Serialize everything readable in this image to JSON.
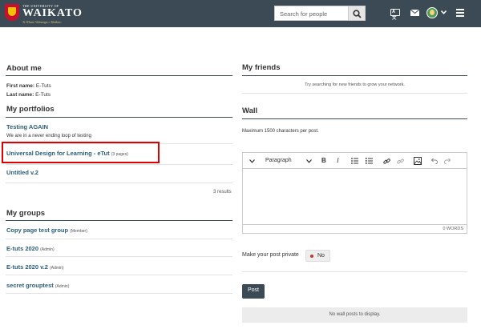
{
  "header": {
    "logo_small": "THE UNIVERSITY OF",
    "logo_name": "WAIKATO",
    "logo_tag": "Te Whare Wānanga o Waikato",
    "search_placeholder": "Search for people",
    "lang_icon_text": "A文"
  },
  "about": {
    "title": "About me",
    "first_name_label": "First name:",
    "first_name_value": "E-Tuts",
    "last_name_label": "Last name:",
    "last_name_value": "E-Tuts"
  },
  "portfolios": {
    "title": "My portfolios",
    "items": [
      {
        "title": "Testing AGAIN",
        "meta": "",
        "description": "We are in a never ending loop of testing"
      },
      {
        "title": "Universal Design for Learning - eTut",
        "meta": "(3 pages)",
        "description": ""
      },
      {
        "title": "Untitled v.2",
        "meta": "",
        "description": ""
      }
    ],
    "results": "3 results"
  },
  "groups": {
    "title": "My groups",
    "items": [
      {
        "name": "Copy page test group",
        "role": "(Member)"
      },
      {
        "name": "E-tuts 2020",
        "role": "(Admin)"
      },
      {
        "name": "E-tuts 2020 v.2",
        "role": "(Admin)"
      },
      {
        "name": "secret grouptest",
        "role": "(Admin)"
      }
    ]
  },
  "friends": {
    "title": "My friends",
    "message": "Try searching for new friends to grow your network."
  },
  "wall": {
    "title": "Wall",
    "max_chars": "Maximum 1500 characters per post.",
    "paragraph_label": "Paragraph",
    "word_count": "0 WORDS",
    "private_label": "Make your post private",
    "private_value": "No",
    "post_button": "Post",
    "empty_message": "No wall posts to display."
  },
  "colors": {
    "header_bg": "#3b4a55",
    "link": "#2d5e7a",
    "highlight_border": "#e00000"
  }
}
